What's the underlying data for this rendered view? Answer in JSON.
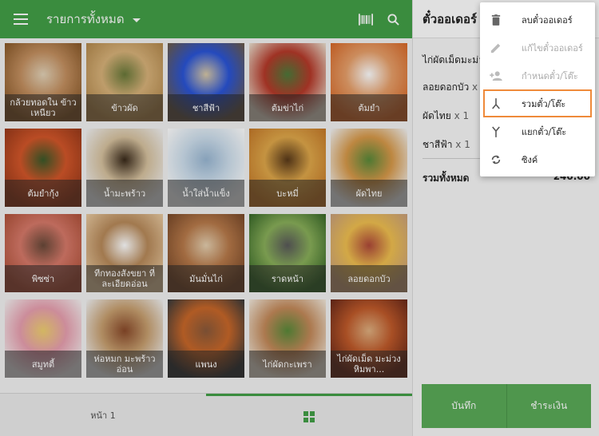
{
  "header": {
    "category_title": "รายการทั้งหมด"
  },
  "products": [
    {
      "name": "กล้วยทอดใน ข้าวเหนียว",
      "colors": [
        "#8a5a2a",
        "#c49060",
        "#e4d3b8"
      ]
    },
    {
      "name": "ข้าวผัด",
      "colors": [
        "#b48a4e",
        "#d9b37a",
        "#6a7a3a"
      ]
    },
    {
      "name": "ชาสีฟ้า",
      "colors": [
        "#6a5a4a",
        "#2a55d8",
        "#d9c9a8"
      ]
    },
    {
      "name": "ต้มข่าไก่",
      "colors": [
        "#e9dccb",
        "#b63a2a",
        "#4f7a3a"
      ]
    },
    {
      "name": "ต้มยำ",
      "colors": [
        "#d86a2a",
        "#e8a06a",
        "#ffffff"
      ]
    },
    {
      "name": "ต้มยำกุ้ง",
      "colors": [
        "#9a3a1a",
        "#d4572a",
        "#3b5a2a"
      ]
    },
    {
      "name": "น้ำมะพร้าว",
      "colors": [
        "#f1f1f1",
        "#d8c3a0",
        "#3a2a1a"
      ]
    },
    {
      "name": "น้ำใส่น้ำแข็ง",
      "colors": [
        "#ffffff",
        "#cfe0ee",
        "#9ab8d4"
      ]
    },
    {
      "name": "บะหมี่",
      "colors": [
        "#c57a2a",
        "#e0a84a",
        "#5a3a1a"
      ]
    },
    {
      "name": "ผัดไทย",
      "colors": [
        "#f2f2f2",
        "#d89a4a",
        "#5a8a3a"
      ]
    },
    {
      "name": "พิซซ่า",
      "colors": [
        "#b0523a",
        "#d87a6a",
        "#6a4a3a"
      ]
    },
    {
      "name": "ทีกทองสังขยา ที่ละเอียดอ่อน",
      "colors": [
        "#e8c9a0",
        "#b88a5a",
        "#ffffff"
      ]
    },
    {
      "name": "มันมั่นไก่",
      "colors": [
        "#7a4a2a",
        "#b87a4a",
        "#e6d0b0"
      ]
    },
    {
      "name": "ราดหน้า",
      "colors": [
        "#3a6a2a",
        "#8ab05a",
        "#5a5a5a"
      ]
    },
    {
      "name": "ลอยดอกบัว",
      "colors": [
        "#c9a07a",
        "#f0c050",
        "#b04a3a"
      ]
    },
    {
      "name": "สมูทตี้",
      "colors": [
        "#f4f0f0",
        "#e9a0b0",
        "#f0d070"
      ]
    },
    {
      "name": "ห่อหมก มะพร้าวอ่อน",
      "colors": [
        "#f0f0f0",
        "#c8a070",
        "#8a4a2a"
      ]
    },
    {
      "name": "แพนง",
      "colors": [
        "#3a3a3a",
        "#c9682a",
        "#8a5a3a"
      ]
    },
    {
      "name": "ไก่ผัดกะเพรา",
      "colors": [
        "#f0e6d8",
        "#c48a5a",
        "#5a8a3a"
      ]
    },
    {
      "name": "ไก่ผัดเม็ด มะม่วงหิมพา...",
      "colors": [
        "#6a2a1a",
        "#c05a2a",
        "#e0b080"
      ]
    }
  ],
  "bottom_nav": {
    "page_label": "หน้า 1"
  },
  "ticket": {
    "title": "ตั๋วออเดอร์",
    "items": [
      {
        "name": "ไก่ผัดเม็ดมะม่วง",
        "qty": ""
      },
      {
        "name": "ลอยดอกบัว",
        "qty": "x 1"
      },
      {
        "name": "ผัดไทย",
        "qty": "x 1"
      },
      {
        "name": "ชาสีฟ้า",
        "qty": "x 1"
      }
    ],
    "total_label": "รวมทั้งหมด",
    "total_value": "240.00",
    "save_label": "บันทึก",
    "pay_label": "ชำระเงิน"
  },
  "menu": {
    "items": [
      {
        "label": "ลบตั๋วออเดอร์",
        "icon": "trash-icon",
        "disabled": false
      },
      {
        "label": "แก้ไขตั๋วออเดอร์",
        "icon": "pencil-icon",
        "disabled": true
      },
      {
        "label": "กำหนดตั๋ว/โต๊ะ",
        "icon": "assign-person-icon",
        "disabled": true
      },
      {
        "label": "รวมตั๋ว/โต๊ะ",
        "icon": "merge-icon",
        "disabled": false
      },
      {
        "label": "แยกตั๋ว/โต๊ะ",
        "icon": "split-icon",
        "disabled": false
      },
      {
        "label": "ซิงค์",
        "icon": "sync-icon",
        "disabled": false
      }
    ]
  },
  "colors": {
    "primary": "#43a047",
    "button": "#5aab58",
    "highlight": "#ef8a3a"
  }
}
